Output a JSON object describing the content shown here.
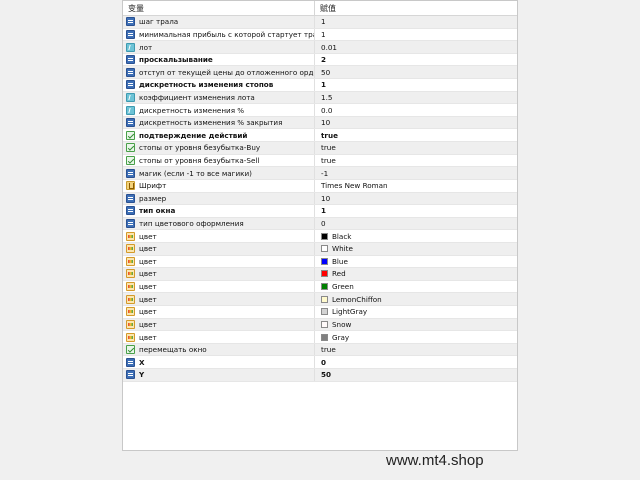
{
  "header": {
    "col_name": "变量",
    "col_value": "赋值"
  },
  "rows": [
    {
      "name": "шаг трала",
      "value": "1",
      "type": "int"
    },
    {
      "name": "минимальная прибыль с которой стартует тра?..",
      "value": "1",
      "type": "int"
    },
    {
      "name": "лот",
      "value": "0.01",
      "type": "double"
    },
    {
      "name": "проскальзывание",
      "value": "2",
      "type": "int"
    },
    {
      "name": "отступ от текущей цены до отложенного ордера",
      "value": "50",
      "type": "int"
    },
    {
      "name": "дискретность изменения стопов",
      "value": "1",
      "type": "int"
    },
    {
      "name": "коэффициент изменения лота",
      "value": "1.5",
      "type": "double"
    },
    {
      "name": "дискретность изменения %",
      "value": "0.0",
      "type": "double"
    },
    {
      "name": "дискретность изменения % закрытия",
      "value": "10",
      "type": "int"
    },
    {
      "name": "подтверждение действий",
      "value": "true",
      "type": "bool"
    },
    {
      "name": "стопы от уровня безубытка-Buy",
      "value": "true",
      "type": "bool"
    },
    {
      "name": "стопы от уровня безубытка-Sell",
      "value": "true",
      "type": "bool"
    },
    {
      "name": "магик (если -1 то все магики)",
      "value": "-1",
      "type": "int"
    },
    {
      "name": "Шрифт",
      "value": "Times New Roman",
      "type": "font"
    },
    {
      "name": "размер",
      "value": "10",
      "type": "int"
    },
    {
      "name": "тип окна",
      "value": "1",
      "type": "int"
    },
    {
      "name": "тип цветового оформления",
      "value": "0",
      "type": "int"
    },
    {
      "name": "цвет",
      "value": "Black",
      "type": "color",
      "swatch": "#000000"
    },
    {
      "name": "цвет",
      "value": "White",
      "type": "color",
      "swatch": "#ffffff"
    },
    {
      "name": "цвет",
      "value": "Blue",
      "type": "color",
      "swatch": "#0000ff"
    },
    {
      "name": "цвет",
      "value": "Red",
      "type": "color",
      "swatch": "#ff0000"
    },
    {
      "name": "цвет",
      "value": "Green",
      "type": "color",
      "swatch": "#008000"
    },
    {
      "name": "цвет",
      "value": "LemonChiffon",
      "type": "color",
      "swatch": "#fffacd"
    },
    {
      "name": "цвет",
      "value": "LightGray",
      "type": "color",
      "swatch": "#d3d3d3"
    },
    {
      "name": "цвет",
      "value": "Snow",
      "type": "color",
      "swatch": "#fffafa"
    },
    {
      "name": "цвет",
      "value": "Gray",
      "type": "color",
      "swatch": "#808080"
    },
    {
      "name": "перемещать окно",
      "value": "true",
      "type": "bool"
    },
    {
      "name": "X",
      "value": "0",
      "type": "int"
    },
    {
      "name": "Y",
      "value": "50",
      "type": "int"
    }
  ],
  "watermark": "www.mt4.shop"
}
